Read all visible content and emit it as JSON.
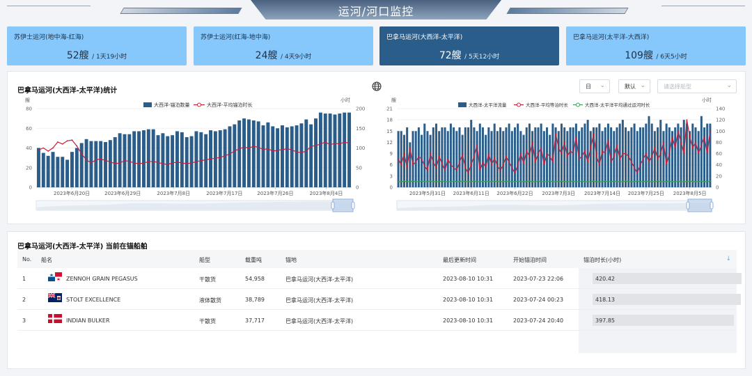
{
  "header": {
    "title": "运河/河口监控"
  },
  "stat_cards": [
    {
      "name": "苏伊士运河(地中海-红海)",
      "count": "52艘",
      "duration": "/ 1天19小时",
      "active": false
    },
    {
      "name": "苏伊士运河(红海-地中海)",
      "count": "24艘",
      "duration": "/ 4天9小时",
      "active": false
    },
    {
      "name": "巴拿马运河(大西洋-太平洋)",
      "count": "72艘",
      "duration": "/ 5天12小时",
      "active": true
    },
    {
      "name": "巴拿马运河(太平洋-大西洋)",
      "count": "109艘",
      "duration": "/ 6天5小时",
      "active": false
    }
  ],
  "left_chart": {
    "title": "巴拿马运河(大西洋-太平洋)统计",
    "y_left_unit": "艘",
    "y_right_unit": "小时",
    "legend": [
      "大西洋-锚泊数量",
      "大西洋-平均锚泊时长"
    ]
  },
  "right_chart": {
    "y_left_unit": "艘",
    "y_right_unit": "小时",
    "legend": [
      "大西洋-太平洋流量",
      "大西洋-平均等泊时长",
      "大西洋-太平洋平均通过运河时长"
    ]
  },
  "controls": {
    "period": "日",
    "mode": "默认",
    "ship_type_placeholder": "请选择船型"
  },
  "chart_data": [
    {
      "type": "bar",
      "x_tick_labels": [
        "2023年6月20日",
        "2023年6月29日",
        "2023年7月8日",
        "2023年7月17日",
        "2023年7月26日",
        "2023年8月4日"
      ],
      "y_left_ticks": [
        0,
        20,
        40,
        60,
        80
      ],
      "y_right_ticks": [
        0,
        50,
        100,
        150,
        200
      ],
      "y_left_range": [
        0,
        80
      ],
      "y_right_range": [
        0,
        200
      ],
      "series": [
        {
          "name": "大西洋-锚泊数量",
          "kind": "bar",
          "axis": "left",
          "color": "#2b5d8a",
          "values": [
            40,
            35,
            32,
            36,
            31,
            31,
            28,
            36,
            40,
            45,
            49,
            47,
            47,
            47,
            46,
            48,
            51,
            55,
            54,
            54,
            57,
            57,
            58,
            59,
            59,
            53,
            55,
            52,
            53,
            57,
            56,
            51,
            52,
            57,
            56,
            54,
            58,
            57,
            58,
            59,
            62,
            64,
            68,
            70,
            69,
            68,
            67,
            63,
            66,
            62,
            60,
            63,
            61,
            62,
            63,
            65,
            69,
            64,
            70,
            76,
            75,
            75,
            74,
            75,
            76,
            76
          ]
        },
        {
          "name": "大西洋-平均锚泊时长",
          "kind": "line",
          "axis": "right",
          "color": "#c4203c",
          "values": [
            95,
            100,
            92,
            100,
            115,
            110,
            118,
            120,
            105,
            85,
            70,
            62,
            70,
            72,
            68,
            65,
            60,
            62,
            68,
            66,
            62,
            60,
            62,
            65,
            66,
            63,
            60,
            58,
            62,
            64,
            62,
            60,
            62,
            65,
            68,
            70,
            72,
            74,
            76,
            80,
            85,
            92,
            98,
            102,
            100,
            104,
            102,
            96,
            98,
            92,
            94,
            96,
            98,
            95,
            90,
            88,
            92,
            104,
            106,
            110,
            115,
            108,
            112,
            110,
            115,
            112
          ]
        }
      ]
    },
    {
      "type": "bar",
      "x_tick_labels": [
        "2023年5月31日",
        "2023年6月11日",
        "2023年6月22日",
        "2023年7月3日",
        "2023年7月14日",
        "2023年7月25日",
        "2023年8月5日"
      ],
      "y_left_ticks": [
        0,
        3,
        6,
        9,
        12,
        15,
        18,
        21
      ],
      "y_right_ticks": [
        0,
        20,
        40,
        60,
        80,
        100,
        120,
        140
      ],
      "y_left_range": [
        0,
        21
      ],
      "y_right_range": [
        0,
        140
      ],
      "series": [
        {
          "name": "大西洋-太平洋流量",
          "kind": "bar",
          "axis": "left",
          "color": "#2b5d8a",
          "values": [
            15,
            15,
            14,
            16,
            12,
            15,
            15,
            16,
            14,
            17,
            15,
            14,
            16,
            17,
            15,
            16,
            16,
            15,
            17,
            16,
            15,
            16,
            14,
            16,
            16,
            18,
            16,
            15,
            17,
            16,
            14,
            16,
            15,
            17,
            15,
            16,
            15,
            16,
            17,
            15,
            16,
            17,
            15,
            14,
            16,
            17,
            15,
            16,
            16,
            17,
            15,
            16,
            14,
            17,
            16,
            15,
            17,
            16,
            15,
            16,
            16,
            17,
            15,
            16,
            17,
            18,
            15,
            16,
            16,
            17,
            15,
            16,
            17,
            16,
            15,
            16,
            17,
            18,
            16,
            15,
            16,
            17,
            15,
            16,
            16,
            17,
            19,
            17,
            15,
            16,
            18,
            15,
            17,
            16,
            15,
            16,
            17,
            16,
            18,
            17,
            15,
            17,
            16,
            15,
            19,
            16,
            17,
            17
          ]
        },
        {
          "name": "大西洋-平均等泊时长",
          "kind": "line",
          "axis": "right",
          "color": "#c4203c",
          "values": [
            50,
            40,
            60,
            35,
            70,
            40,
            45,
            55,
            50,
            38,
            30,
            60,
            45,
            35,
            55,
            42,
            30,
            50,
            40,
            35,
            30,
            45,
            58,
            35,
            25,
            40,
            55,
            75,
            30,
            45,
            35,
            60,
            40,
            52,
            38,
            30,
            40,
            55,
            45,
            35,
            25,
            40,
            60,
            42,
            65,
            55,
            80,
            45,
            60,
            70,
            40,
            60,
            55,
            45,
            95,
            70,
            60,
            80,
            55,
            65,
            60,
            90,
            50,
            55,
            65,
            45,
            70,
            95,
            55,
            40,
            65,
            60,
            85,
            45,
            55,
            75,
            50,
            60,
            60,
            55,
            45,
            35,
            25,
            40,
            50,
            60,
            45,
            55,
            70,
            50,
            60,
            80,
            40,
            60,
            90,
            70,
            100,
            80,
            60,
            120,
            90,
            70,
            80,
            60,
            75,
            90,
            60,
            100
          ]
        },
        {
          "name": "大西洋-太平洋平均通过运河时长",
          "kind": "line",
          "axis": "right",
          "color": "#3a9a5a",
          "values": [
            10,
            10,
            11,
            10,
            10,
            11,
            10,
            10,
            11,
            10,
            10,
            11,
            10,
            10,
            10,
            11,
            10,
            10,
            10,
            11,
            10,
            10,
            11,
            10,
            10,
            10,
            11,
            10,
            10,
            10,
            11,
            10,
            10,
            11,
            10,
            10,
            10,
            11,
            10,
            10,
            10,
            11,
            10,
            10,
            10,
            11,
            10,
            10,
            11,
            10,
            10,
            10,
            11,
            10,
            10,
            10,
            11,
            10,
            10,
            10,
            11,
            10,
            10,
            11,
            10,
            10,
            10,
            11,
            10,
            10,
            10,
            11,
            10,
            10,
            11,
            10,
            10,
            10,
            11,
            10,
            10,
            10,
            11,
            10,
            10,
            11,
            10,
            10,
            10,
            11,
            10,
            10,
            10,
            11,
            10,
            10,
            11,
            10,
            10,
            10,
            11,
            10,
            10,
            10,
            11,
            10,
            10,
            11
          ]
        }
      ]
    }
  ],
  "table": {
    "title": "巴拿马运河(大西洋-太平洋) 当前在锚船舶",
    "columns": [
      "No.",
      "船名",
      "船型",
      "载重吨",
      "锚地",
      "最后更新时间",
      "开始锚泊时间",
      "锚泊时长(小时)"
    ],
    "rows": [
      {
        "no": "1",
        "flag": "panama-flag",
        "name": "ZENNOH GRAIN PEGASUS",
        "type": "干散货",
        "dwt": "54,958",
        "anchorage": "巴拿马运河(大西洋-太平洋)",
        "updated": "2023-08-10 10:31",
        "start": "2023-07-23 22:06",
        "hours": "420.42",
        "hours_value": 420.42
      },
      {
        "no": "2",
        "flag": "cayman-islands-flag",
        "name": "STOLT EXCELLENCE",
        "type": "液体散货",
        "dwt": "38,789",
        "anchorage": "巴拿马运河(大西洋-太平洋)",
        "updated": "2023-08-10 10:31",
        "start": "2023-07-24 00:23",
        "hours": "418.13",
        "hours_value": 418.13
      },
      {
        "no": "3",
        "flag": "denmark-flag",
        "name": "INDIAN BULKER",
        "type": "干散货",
        "dwt": "37,717",
        "anchorage": "巴拿马运河(大西洋-太平洋)",
        "updated": "2023-08-10 10:31",
        "start": "2023-07-24 20:40",
        "hours": "397.85",
        "hours_value": 397.85
      }
    ]
  }
}
